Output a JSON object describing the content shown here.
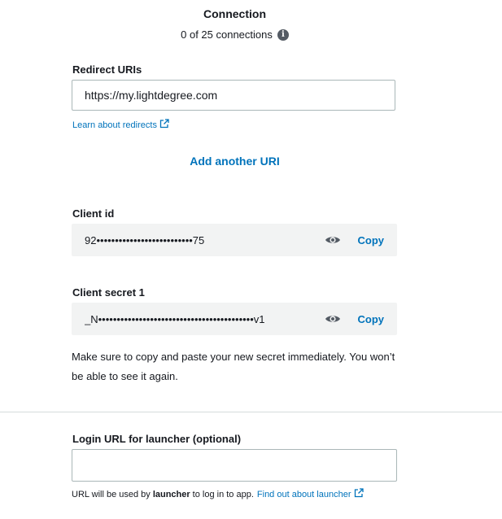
{
  "header": {
    "title": "Connection",
    "subtitle": "0 of 25 connections",
    "info_icon": "info-icon"
  },
  "redirect": {
    "label": "Redirect URIs",
    "value": "https://my.lightdegree.com",
    "learn_link": "Learn about redirects",
    "add_another": "Add another URI"
  },
  "client_id": {
    "label": "Client id",
    "masked_value": "92••••••••••••••••••••••••••75",
    "copy_label": "Copy"
  },
  "client_secret": {
    "label": "Client secret 1",
    "masked_value": "_N••••••••••••••••••••••••••••••••••••••••••v1",
    "copy_label": "Copy",
    "note": "Make sure to copy and paste your new secret immediately. You won’t be able to see it again."
  },
  "launcher": {
    "label": "Login URL for launcher (optional)",
    "value": "",
    "footer_prefix": "URL will be used by",
    "footer_bold": "launcher",
    "footer_suffix": "to log in to app.",
    "footer_link": "Find out about launcher"
  },
  "colors": {
    "link": "#0073bb",
    "text": "#16191f",
    "field_bg": "#f2f3f3",
    "border": "#aab7b8"
  }
}
